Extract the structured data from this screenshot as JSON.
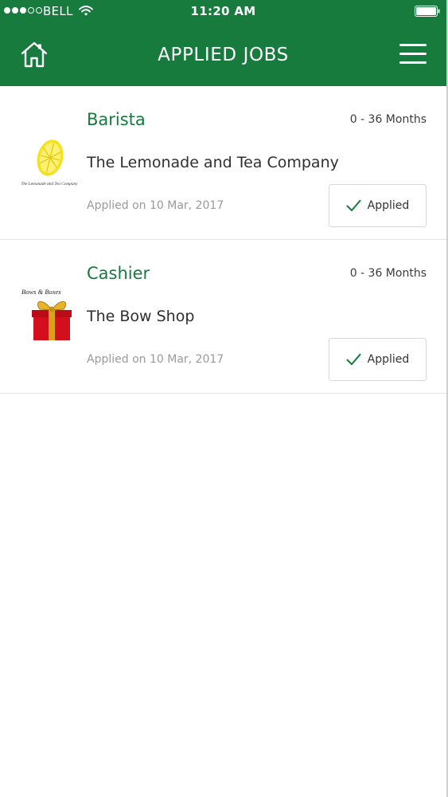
{
  "status_bar": {
    "carrier": "BELL",
    "time": "11:20 AM"
  },
  "header": {
    "title": "APPLIED JOBS"
  },
  "jobs": [
    {
      "title": "Barista",
      "experience": "0 - 36 Months",
      "company": "The Lemonade and Tea Company",
      "applied_on": "Applied on 10 Mar, 2017",
      "status": "Applied",
      "logo_text": "The Lemonade and Tea Company"
    },
    {
      "title": "Cashier",
      "experience": "0 - 36 Months",
      "company": "The Bow Shop",
      "applied_on": "Applied on 10 Mar, 2017",
      "status": "Applied",
      "logo_text": "Bows & Boxes"
    }
  ],
  "colors": {
    "primary": "#167b3d",
    "lemon": "#f5e11c",
    "gift_red": "#d40f1d",
    "gift_gold": "#d9a21a"
  },
  "icons": {
    "home": "home-icon",
    "menu": "hamburger-menu-icon",
    "wifi": "wifi-icon",
    "battery": "battery-icon",
    "applied": "check-icon"
  }
}
